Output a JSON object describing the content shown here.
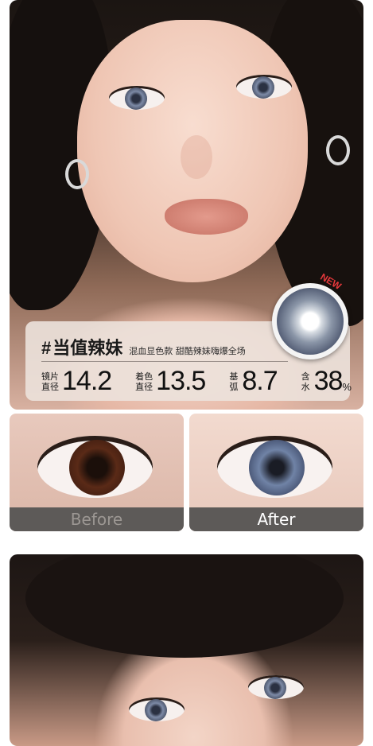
{
  "hero": {
    "new_badge": "NEW",
    "hash": "#",
    "title": "当值辣妹",
    "subtitle": "混血显色款 甜酷辣妹嗨爆全场",
    "specs": [
      {
        "label_line1": "镜片",
        "label_line2": "直径",
        "value": "14.2",
        "unit": ""
      },
      {
        "label_line1": "着色",
        "label_line2": "直径",
        "value": "13.5",
        "unit": ""
      },
      {
        "label_line1": "基",
        "label_line2": "弧",
        "value": "8.7",
        "unit": ""
      },
      {
        "label_line1": "含",
        "label_line2": "水",
        "value": "38",
        "unit": "%"
      }
    ]
  },
  "comparison": {
    "before_label": "Before",
    "after_label": "After"
  }
}
